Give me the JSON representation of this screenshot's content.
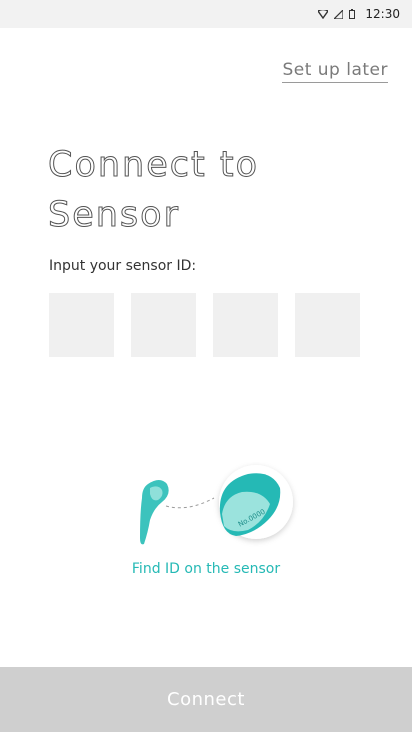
{
  "status_bar": {
    "time": "12:30",
    "icons": [
      "wifi-icon",
      "signal-icon",
      "battery-icon"
    ]
  },
  "header": {
    "setup_later_label": "Set up later"
  },
  "main": {
    "title_line1": "Connect to",
    "title_line2": "Sensor",
    "input_label": "Input your sensor ID:",
    "id_fields": [
      "",
      "",
      "",
      ""
    ],
    "sensor_tag_text": "No.0000",
    "find_id_label": "Find ID on the sensor"
  },
  "footer": {
    "connect_label": "Connect"
  },
  "colors": {
    "accent": "#25b9b5",
    "disabled_button": "#cfcfcf",
    "input_bg": "#f0f0f0"
  }
}
